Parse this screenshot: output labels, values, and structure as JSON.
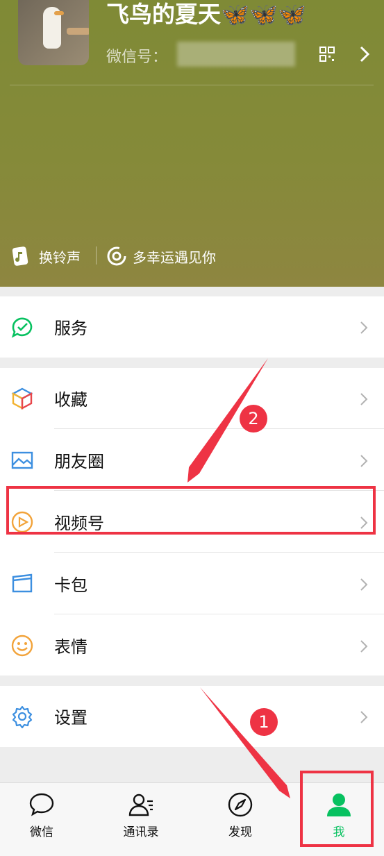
{
  "profile": {
    "nickname": "飞鸟的夏天🦋🦋🦋",
    "wechat_id_label": "微信号：",
    "status_left": "换铃声",
    "status_right": "多幸运遇见你"
  },
  "menu": {
    "service": "服务",
    "favorites": "收藏",
    "moments": "朋友圈",
    "channels": "视频号",
    "cards": "卡包",
    "stickers": "表情",
    "settings": "设置"
  },
  "tabs": [
    {
      "label": "微信"
    },
    {
      "label": "通讯录"
    },
    {
      "label": "发现"
    },
    {
      "label": "我"
    }
  ],
  "annotations": {
    "step1": "1",
    "step2": "2"
  },
  "colors": {
    "accent_green": "#07c160",
    "annotation_red": "#ee3344"
  }
}
